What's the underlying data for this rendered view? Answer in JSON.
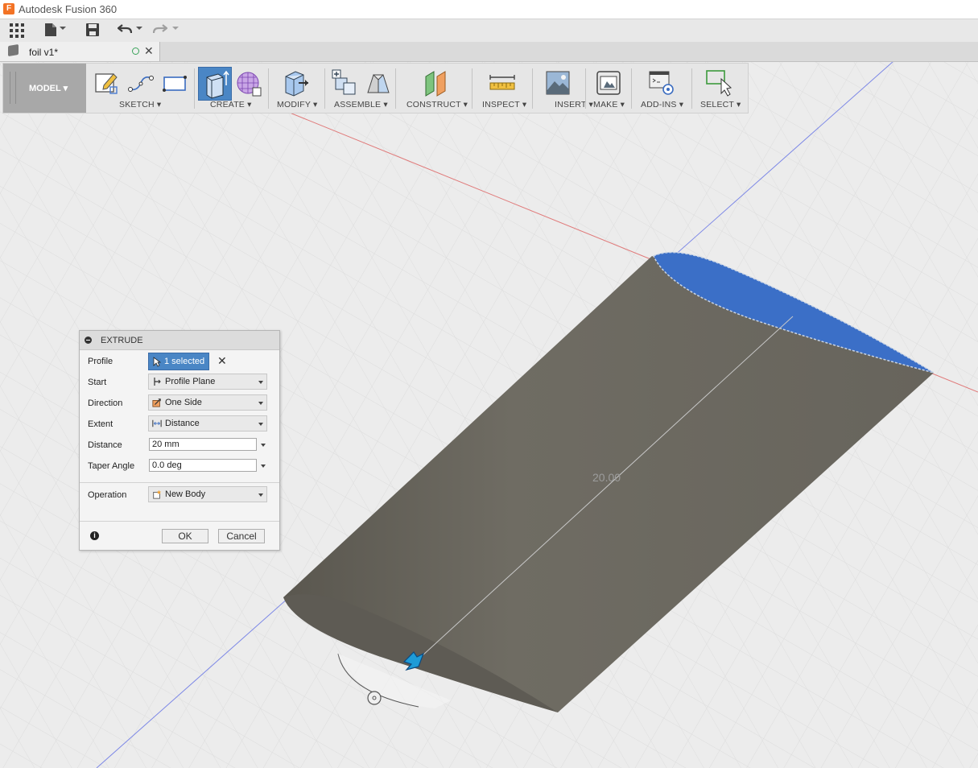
{
  "app": {
    "title": "Autodesk Fusion 360",
    "icon_letter": "F"
  },
  "tab": {
    "name": "foil v1*"
  },
  "ribbon": {
    "workspace": "MODEL",
    "groups": [
      {
        "label": "SKETCH"
      },
      {
        "label": "CREATE"
      },
      {
        "label": "MODIFY"
      },
      {
        "label": "ASSEMBLE"
      },
      {
        "label": "CONSTRUCT"
      },
      {
        "label": "INSPECT"
      },
      {
        "label": "INSERT"
      },
      {
        "label": "MAKE"
      },
      {
        "label": "ADD-INS"
      },
      {
        "label": "SELECT"
      }
    ]
  },
  "dialog": {
    "title": "EXTRUDE",
    "profile_label": "Profile",
    "profile_value": "1 selected",
    "start_label": "Start",
    "start_value": "Profile Plane",
    "direction_label": "Direction",
    "direction_value": "One Side",
    "extent_label": "Extent",
    "extent_value": "Distance",
    "distance_label": "Distance",
    "distance_value": "20 mm",
    "taper_label": "Taper Angle",
    "taper_value": "0.0 deg",
    "operation_label": "Operation",
    "operation_value": "New Body",
    "ok": "OK",
    "cancel": "Cancel"
  },
  "viewport": {
    "dimension": "20.00"
  },
  "colors": {
    "accent": "#3b6fc7",
    "body": "#6e6b62",
    "select_blue": "#4a86c5",
    "x_axis": "#e05050",
    "y_axis": "#5a6ee0"
  }
}
